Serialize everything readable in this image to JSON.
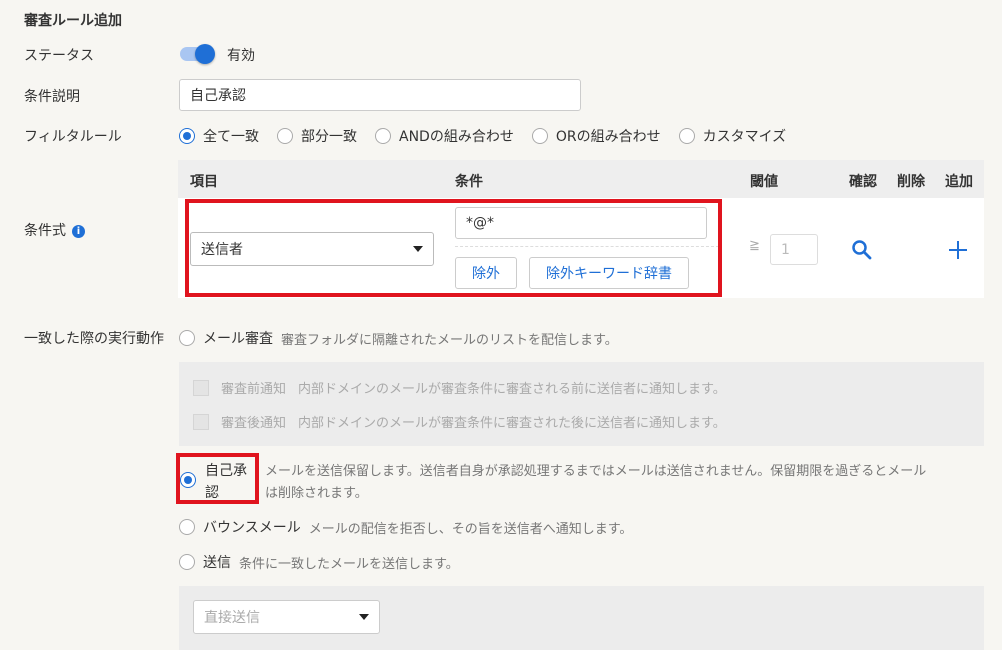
{
  "page_title": "審査ルール追加",
  "status": {
    "label": "ステータス",
    "value_label": "有効",
    "enabled": true
  },
  "condition_desc": {
    "label": "条件説明",
    "value": "自己承認"
  },
  "filter_rule": {
    "label": "フィルタルール",
    "options": [
      "全て一致",
      "部分一致",
      "ANDの組み合わせ",
      "ORの組み合わせ",
      "カスタマイズ"
    ],
    "selected": "全て一致"
  },
  "expression": {
    "label": "条件式",
    "headers": {
      "item": "項目",
      "condition": "条件",
      "threshold": "閾値",
      "confirm": "確認",
      "delete": "削除",
      "add": "追加"
    },
    "row": {
      "item_select": "送信者",
      "condition_value": "*@*",
      "exclude_button": "除外",
      "exclude_dict_button": "除外キーワード辞書",
      "threshold_sign": "≧",
      "threshold_value": "1"
    }
  },
  "action": {
    "label": "一致した際の実行動作",
    "mail_review": {
      "title": "メール審査",
      "desc": "審査フォルダに隔離されたメールのリストを配信します。"
    },
    "pre_notify": {
      "title": "審査前通知",
      "desc": "内部ドメインのメールが審査条件に審査される前に送信者に通知します。"
    },
    "post_notify": {
      "title": "審査後通知",
      "desc": "内部ドメインのメールが審査条件に審査された後に送信者に通知します。"
    },
    "self_approve": {
      "title_line1": "自己承",
      "title_line2": "認",
      "desc_line1": "メールを送信保留します。送信者自身が承認処理するまではメールは送信されません。保留期限を過ぎるとメール",
      "desc_line2": "は削除されます。"
    },
    "bounce": {
      "title": "バウンスメール",
      "desc": "メールの配信を拒否し、その旨を送信者へ通知します。"
    },
    "send": {
      "title": "送信",
      "desc": "条件に一致したメールを送信します。"
    },
    "send_select_placeholder": "直接送信",
    "selected": "self_approve"
  },
  "colors": {
    "accent": "#1f6fd6",
    "highlight_box": "#e0141e"
  }
}
